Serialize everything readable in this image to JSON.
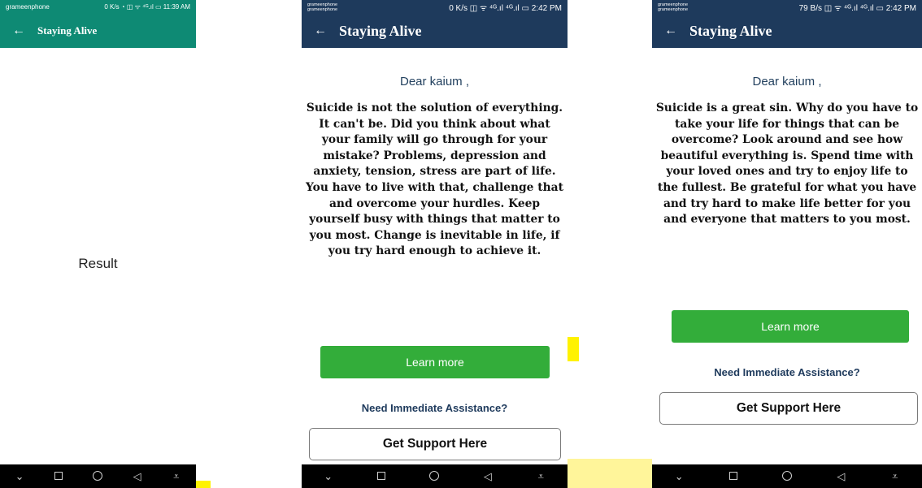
{
  "colors": {
    "teal_appbar": "#0e8a74",
    "navy_appbar": "#1e3a5c",
    "learn_button": "#33ad3a",
    "accent_yellow": "#fff200",
    "nav_bar": "#000000"
  },
  "screens": [
    {
      "status": {
        "carrier": "grameenphone",
        "right": "0 K/s ◔ ◫ ᯤ ⁴ᴳ.ıl ▭ 11:39 AM"
      },
      "appbar": {
        "back_icon": "arrow-left-icon",
        "title": "Staying Alive"
      },
      "result_text": "Result",
      "nav": {
        "icons": [
          "chevron-down-icon",
          "square-icon",
          "circle-icon",
          "triangle-back-icon",
          "download-icon"
        ]
      }
    },
    {
      "status": {
        "carrier": [
          "grameenphone",
          "grameenphone"
        ],
        "right": "0 K/s ◫ ᯤ ⁴ᴳ.ıl ⁴ᴳ.ıl ▭ 2:42 PM"
      },
      "appbar": {
        "back_icon": "arrow-left-icon",
        "title": "Staying Alive"
      },
      "greeting": "Dear kaium ,",
      "message": "Suicide is not the solution of everything. It can't be. Did you think about what your family will go through for your mistake? Problems, depression and anxiety, tension, stress are part of life. You have to live with that, challenge that and overcome your hurdles. Keep yourself busy with things that matter to you most. Change is inevitable in life, if you try hard enough to achieve it.",
      "learn_more": "Learn more",
      "need_help": "Need Immediate Assistance?",
      "support": "Get Support Here",
      "nav": {
        "icons": [
          "chevron-down-icon",
          "square-icon",
          "circle-icon",
          "triangle-back-icon",
          "download-icon"
        ]
      }
    },
    {
      "status": {
        "carrier": [
          "grameenphone",
          "grameenphone"
        ],
        "right": "79 B/s ◫ ᯤ ⁴ᴳ.ıl ⁴ᴳ.ıl ▭ 2:42 PM"
      },
      "appbar": {
        "back_icon": "arrow-left-icon",
        "title": "Staying Alive"
      },
      "greeting": "Dear kaium ,",
      "message": "Suicide is a great sin. Why do you have to take your life for things that can be overcome? Look around and see how beautiful everything is. Spend time with your loved ones and try to enjoy life to the fullest. Be grateful for what you have and try hard to make life better for you and everyone that matters to you most.",
      "learn_more": "Learn more",
      "need_help": "Need Immediate Assistance?",
      "support": "Get Support Here",
      "nav": {
        "icons": [
          "chevron-down-icon",
          "square-icon",
          "circle-icon",
          "triangle-back-icon",
          "download-icon"
        ]
      }
    }
  ]
}
